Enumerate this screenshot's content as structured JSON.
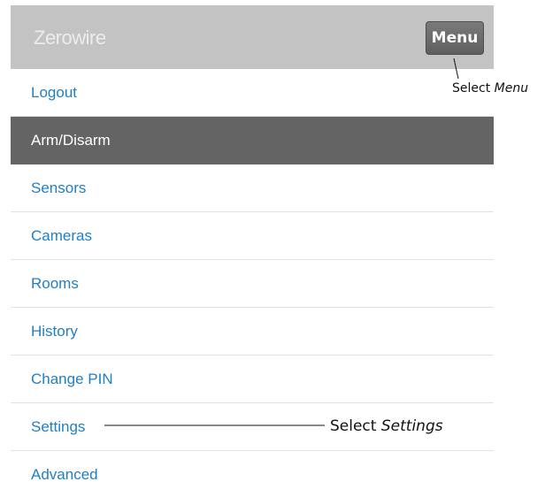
{
  "header": {
    "app_title": "Zerowire",
    "menu_button": "Menu"
  },
  "menu": {
    "items": [
      {
        "label": "Logout",
        "active": false
      },
      {
        "label": "Arm/Disarm",
        "active": true
      },
      {
        "label": "Sensors",
        "active": false
      },
      {
        "label": "Cameras",
        "active": false
      },
      {
        "label": "Rooms",
        "active": false
      },
      {
        "label": "History",
        "active": false
      },
      {
        "label": "Change PIN",
        "active": false
      },
      {
        "label": "Settings",
        "active": false
      },
      {
        "label": "Advanced",
        "active": false
      }
    ]
  },
  "annotations": {
    "menu": {
      "prefix": "Select ",
      "emphasis": "Menu"
    },
    "settings": {
      "prefix": "Select ",
      "emphasis": "Settings"
    }
  },
  "colors": {
    "header_bg": "#c3c3c3",
    "link": "#1f7fc6",
    "active_bg": "#646464"
  }
}
